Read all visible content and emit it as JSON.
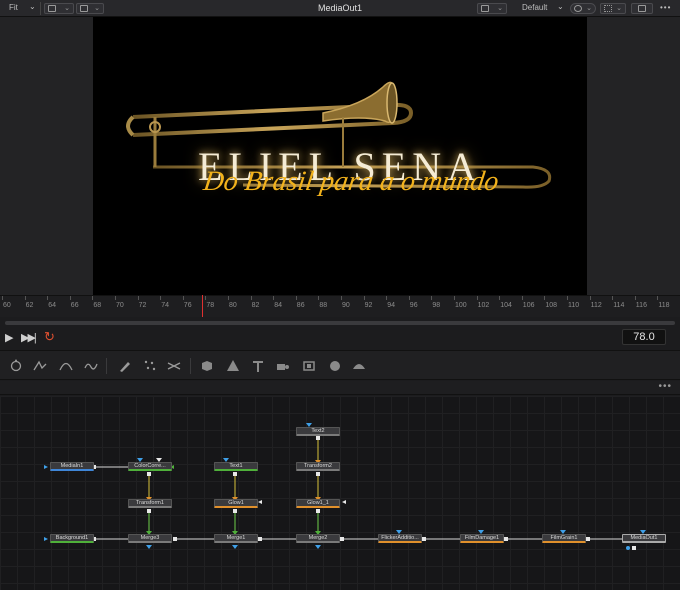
{
  "toolbar": {
    "fit_label": "Fit",
    "title": "MediaOut1",
    "layout_label": "Default",
    "more_label": "•••"
  },
  "ruler": {
    "ticks": [
      "60",
      "62",
      "64",
      "66",
      "68",
      "70",
      "72",
      "74",
      "76",
      "78",
      "80",
      "82",
      "84",
      "86",
      "88",
      "90",
      "92",
      "94",
      "96",
      "98",
      "100",
      "102",
      "104",
      "106",
      "108",
      "110",
      "112",
      "114",
      "116",
      "118"
    ],
    "current_frame": "78.0"
  },
  "viewer": {
    "name_text": "ELIEL  SENA",
    "subtitle_text": "Do Brasil para a o mundo"
  },
  "tools": {
    "icons": [
      "circle-tool-icon",
      "polyline-tool-icon",
      "bspline-tool-icon",
      "bezier-tool-icon",
      "paint-tool-icon",
      "particles-icon",
      "mask-icon",
      "shape3d-icon",
      "merge3d-icon",
      "text3d-icon",
      "camera3d-icon",
      "light3d-icon",
      "renderer3d-icon",
      "fbx-icon",
      "renderer-icon"
    ]
  },
  "nodes": {
    "items": [
      {
        "id": "Text2",
        "label": "Text2"
      },
      {
        "id": "MediaIn1",
        "label": "MediaIn1"
      },
      {
        "id": "ColorCorrector",
        "label": "ColorCorre..."
      },
      {
        "id": "Text1",
        "label": "Text1"
      },
      {
        "id": "Transform2",
        "label": "Transform2"
      },
      {
        "id": "Transform1",
        "label": "Transform1"
      },
      {
        "id": "Glow1",
        "label": "Glow1"
      },
      {
        "id": "Glow1_1",
        "label": "Glow1_1"
      },
      {
        "id": "Background1",
        "label": "Background1"
      },
      {
        "id": "Merge3",
        "label": "Merge3"
      },
      {
        "id": "Merge1",
        "label": "Merge1"
      },
      {
        "id": "Merge2",
        "label": "Merge2"
      },
      {
        "id": "FlickerAddition",
        "label": "FlickerAdditio..."
      },
      {
        "id": "FilmDamage1",
        "label": "FilmDamage1"
      },
      {
        "id": "FilmGrain1",
        "label": "FilmGrain1"
      },
      {
        "id": "MediaOut1",
        "label": "MediaOut1"
      }
    ]
  },
  "colors": {
    "accent_red": "#e03030",
    "node_blue": "#3f86d8",
    "node_green": "#4fb03a",
    "node_orange": "#e0902c",
    "wire_yellow": "#d8c23a"
  }
}
